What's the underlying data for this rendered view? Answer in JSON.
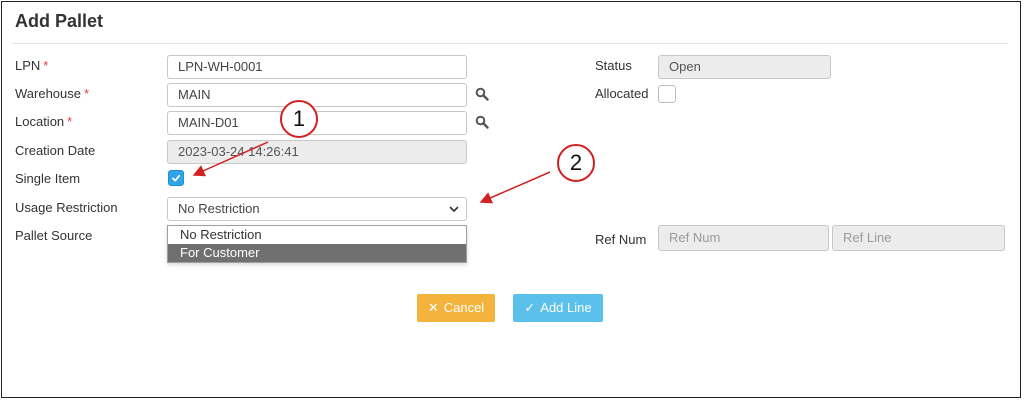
{
  "form": {
    "title": "Add Pallet",
    "required_mark": "*",
    "lpn": {
      "label": "LPN",
      "value": "LPN-WH-0001"
    },
    "warehouse": {
      "label": "Warehouse",
      "value": "MAIN"
    },
    "location": {
      "label": "Location",
      "value": "MAIN-D01"
    },
    "creation_date": {
      "label": "Creation Date",
      "value": "2023-03-24 14:26:41"
    },
    "single_item": {
      "label": "Single Item",
      "checked": true
    },
    "usage_restriction": {
      "label": "Usage Restriction",
      "value": "No Restriction",
      "options": [
        "No Restriction",
        "For Customer"
      ],
      "highlighted": "For Customer"
    },
    "pallet_source": {
      "label": "Pallet Source"
    },
    "status": {
      "label": "Status",
      "value": "Open"
    },
    "allocated": {
      "label": "Allocated",
      "checked": false
    },
    "ref": {
      "label": "Ref Num",
      "num_placeholder": "Ref Num",
      "line_placeholder": "Ref Line"
    }
  },
  "buttons": {
    "cancel": "Cancel",
    "add_line": "Add Line"
  },
  "callouts": {
    "one": "1",
    "two": "2"
  },
  "icons": {
    "search": "search-icon",
    "checkbox_check": "check-icon",
    "select_arrow": "chevron-down-icon",
    "cancel": "close-icon",
    "add_line": "check-icon"
  },
  "colors": {
    "required": "#e53935",
    "checkbox": "#2fa4e7",
    "cancel": "#f3b33d",
    "add_line": "#5bc0eb",
    "annotation": "#d32020"
  }
}
